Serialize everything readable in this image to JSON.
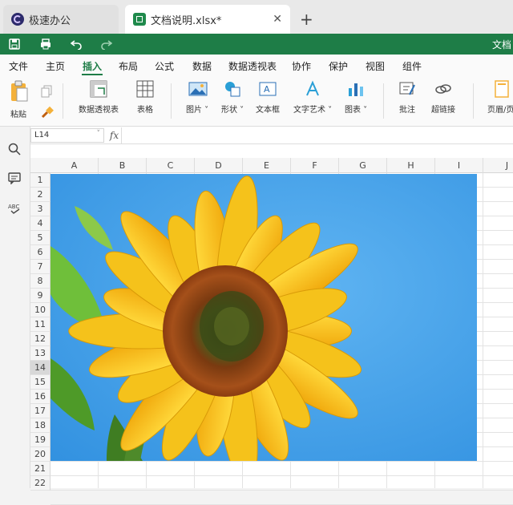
{
  "tabs": [
    {
      "label": "极速办公"
    },
    {
      "label": "文档说明.xlsx*"
    }
  ],
  "quickbar": {
    "doc_title": "文档"
  },
  "menu": [
    {
      "label": "文件"
    },
    {
      "label": "主页"
    },
    {
      "label": "插入"
    },
    {
      "label": "布局"
    },
    {
      "label": "公式"
    },
    {
      "label": "数据"
    },
    {
      "label": "数据透视表"
    },
    {
      "label": "协作"
    },
    {
      "label": "保护"
    },
    {
      "label": "视图"
    },
    {
      "label": "组件"
    }
  ],
  "ribbon": {
    "paste": "粘贴",
    "pivot": "数据透视表",
    "table": "表格",
    "picture": "图片",
    "shape": "形状",
    "textbox": "文本框",
    "wordart": "文字艺术",
    "chart": "图表",
    "comment": "批注",
    "hyperlink": "超链接",
    "header": "页眉/页"
  },
  "formula": {
    "cell_ref": "L14",
    "fx": "fx"
  },
  "columns": [
    "A",
    "B",
    "C",
    "D",
    "E",
    "F",
    "G",
    "H",
    "I",
    "J"
  ],
  "rows": [
    "1",
    "2",
    "3",
    "4",
    "5",
    "6",
    "7",
    "8",
    "9",
    "10",
    "11",
    "12",
    "13",
    "14",
    "15",
    "16",
    "17",
    "18",
    "19",
    "20",
    "21",
    "22"
  ],
  "selected_row": "14",
  "colors": {
    "accent": "#1e7d47",
    "sky": "#3a9ae8",
    "petal": "#f5c21b"
  }
}
